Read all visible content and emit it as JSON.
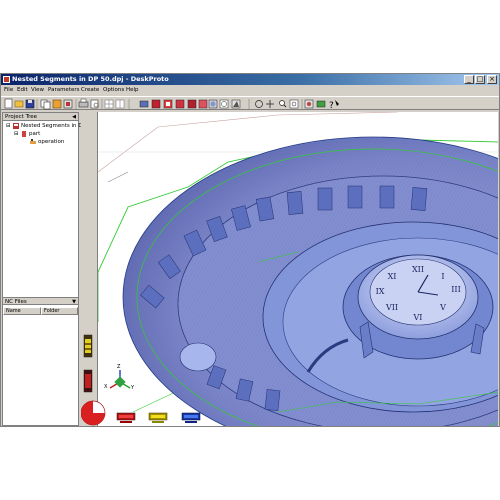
{
  "window": {
    "title": "Nested Segments in DP 50.dpj - DeskProto",
    "controls": {
      "minimize": "_",
      "maximize": "□",
      "close": "×"
    }
  },
  "menu": [
    "File",
    "Edit",
    "View",
    "Parameters",
    "Create",
    "Options",
    "Help"
  ],
  "toolbar_icons": [
    "new-icon",
    "open-icon",
    "save-icon",
    "copy-icon",
    "undo-icon",
    "import-icon",
    "print-icon",
    "print-preview-icon",
    "grid-icon",
    "grid-alt-icon",
    "view-front-icon",
    "view-solid-icon",
    "view-toolpath-icon",
    "view-layer-icon",
    "view-part-icon",
    "view-color-icon",
    "view-shade-icon",
    "view-wire-icon",
    "view-3d-icon",
    "rotate-icon",
    "pan-icon",
    "zoom-icon",
    "zoom-fit-icon",
    "simulate-icon",
    "export-icon",
    "help-icon"
  ],
  "project_tree": {
    "header": "Project Tree",
    "items": [
      {
        "label": "Nested Segments in DP",
        "level": 0
      },
      {
        "label": "part",
        "level": 1
      },
      {
        "label": "operation",
        "level": 2
      }
    ]
  },
  "nc_files": {
    "header": "NC Files",
    "columns": [
      "Name",
      "Folder"
    ]
  },
  "status_gauges": [
    "gauge-red",
    "gauge-yellow",
    "gauge-blue"
  ],
  "colors": {
    "title_start": "#0a246a",
    "title_end": "#a6caf0",
    "model": "#7f95d8",
    "toolpath_green": "#33cc33",
    "toolpath_red": "#e0304a"
  }
}
